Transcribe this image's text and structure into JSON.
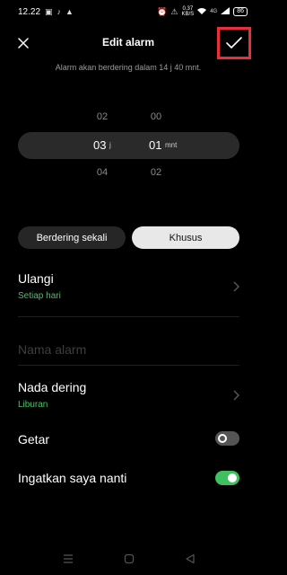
{
  "status_bar": {
    "time": "12.22",
    "speed_value": "0.37",
    "speed_unit": "KB/S",
    "battery": "86",
    "signal_label": "4G"
  },
  "header": {
    "title": "Edit alarm"
  },
  "subtitle": "Alarm akan berdering dalam 14 j 40 mnt.",
  "picker": {
    "hours": [
      "02",
      "03",
      "04"
    ],
    "minutes": [
      "00",
      "01",
      "02"
    ],
    "hour_unit": "j",
    "minute_unit": "mnt"
  },
  "repeat_mode": {
    "options": [
      "Berdering sekali",
      "Khusus"
    ],
    "selected": "Khusus"
  },
  "repeat": {
    "label": "Ulangi",
    "value": "Setiap hari"
  },
  "alarm_name": {
    "value": "",
    "placeholder": "Nama alarm"
  },
  "ringtone": {
    "label": "Nada dering",
    "value": "Liburan"
  },
  "vibrate": {
    "label": "Getar",
    "enabled": false
  },
  "snooze": {
    "label": "Ingatkan saya nanti",
    "enabled": true
  },
  "colors": {
    "background": "#000000",
    "accent_green": "#3fbf5f",
    "highlight_red": "#e8303a",
    "selected_segment": "#e8e8e8"
  }
}
